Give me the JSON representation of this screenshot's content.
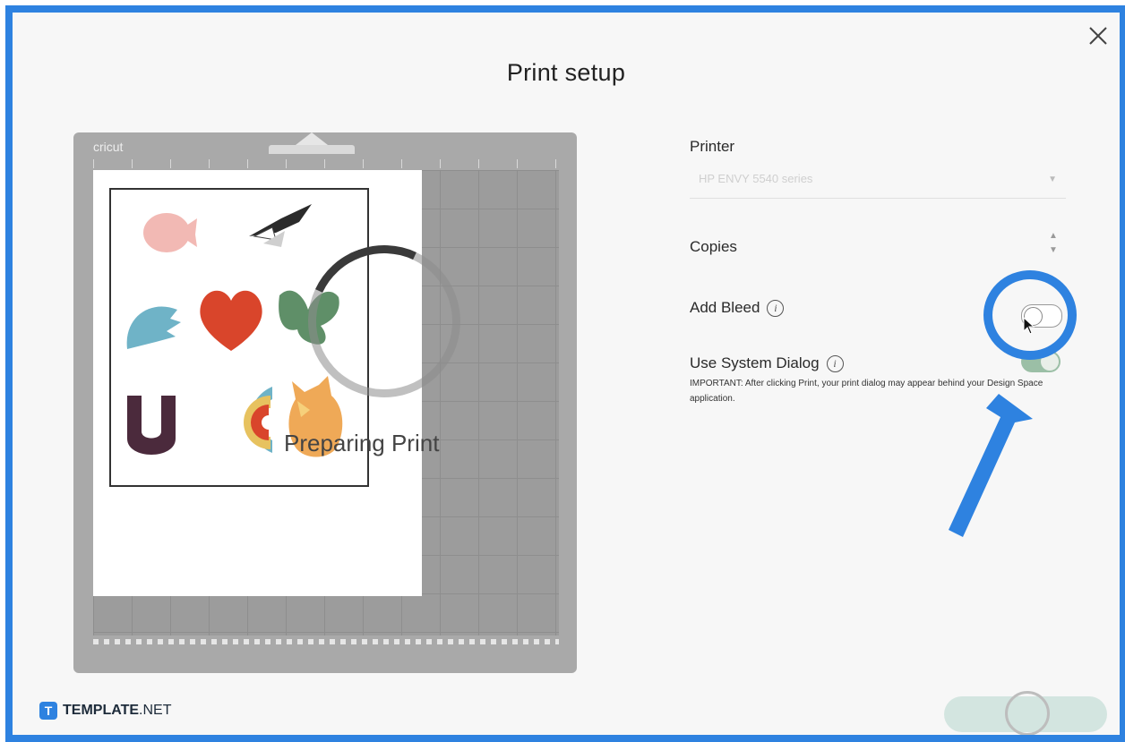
{
  "dialog": {
    "title": "Print setup"
  },
  "mat": {
    "brand": "cricut",
    "overlay_text": "Preparing Print"
  },
  "form": {
    "printer_label": "Printer",
    "printer_value": "HP ENVY 5540 series",
    "copies_label": "Copies",
    "add_bleed_label": "Add Bleed",
    "add_bleed_enabled": false,
    "system_dialog_label": "Use System Dialog",
    "system_dialog_enabled": true,
    "important_note": "IMPORTANT: After clicking Print, your print dialog may appear behind your Design Space application."
  },
  "footer": {
    "brand_bold": "TEMPLATE",
    "brand_light": ".NET"
  },
  "colors": {
    "accent": "#2e82e0",
    "print_button": "#d3e5e0",
    "toggle_on": "#9bbfa6"
  },
  "icons": [
    "close-icon",
    "info-icon",
    "chevron-down-icon",
    "stepper-icon",
    "cursor-icon"
  ]
}
